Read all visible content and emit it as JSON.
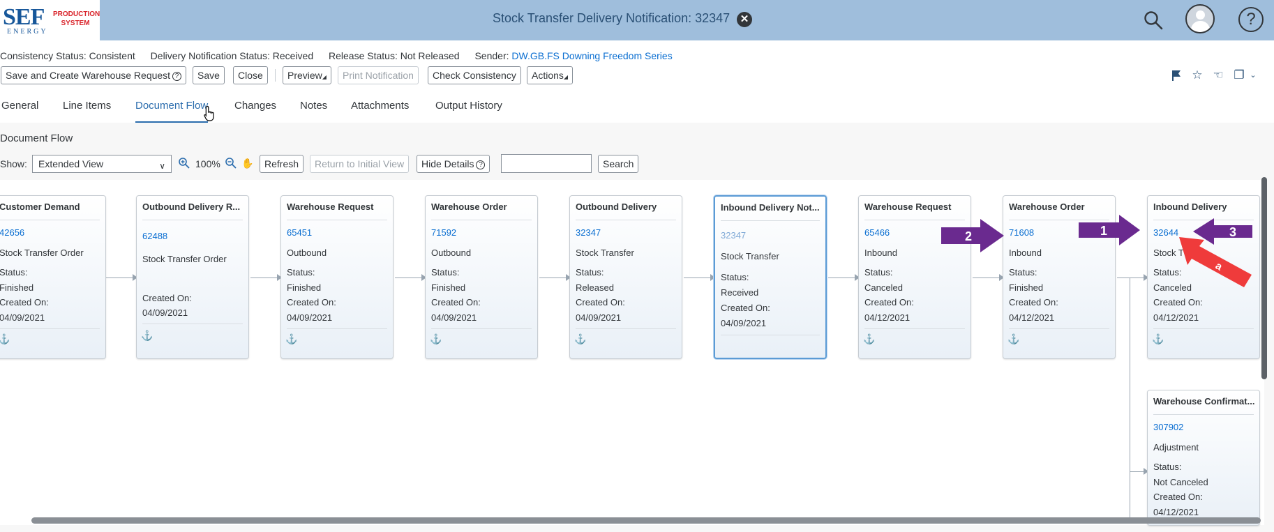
{
  "header": {
    "logo_text": "SEF",
    "logo_sub": "ENERGY",
    "logo_product": "PRODUCTION SYSTEM",
    "title": "Stock Transfer Delivery Notification: 32347"
  },
  "status": {
    "consistency_label": "Consistency Status:",
    "consistency_value": "Consistent",
    "dn_label": "Delivery Notification Status:",
    "dn_value": "Received",
    "release_label": "Release Status:",
    "release_value": "Not Released",
    "sender_label": "Sender:",
    "sender_value": "DW.GB.FS Downing Freedom Series"
  },
  "toolbar": {
    "save_create": "Save and Create Warehouse Request",
    "save": "Save",
    "close": "Close",
    "preview": "Preview",
    "print": "Print Notification",
    "check": "Check Consistency",
    "actions": "Actions"
  },
  "tabs": [
    "General",
    "Line Items",
    "Document Flow",
    "Changes",
    "Notes",
    "Attachments",
    "Output History"
  ],
  "flow": {
    "section_title": "Document Flow",
    "show_label": "Show:",
    "show_value": "Extended View",
    "zoom": "100%",
    "refresh": "Refresh",
    "return": "Return to Initial View",
    "hide_details": "Hide Details",
    "search": "Search",
    "search_value": ""
  },
  "nodes": [
    {
      "title": "Customer Demand",
      "id": "42656",
      "type": "Stock Transfer Order",
      "status_label": "Status:",
      "status": "Finished",
      "created_label": "Created On:",
      "date": "04/09/2021"
    },
    {
      "title": "Outbound Delivery R...",
      "id": "62488",
      "type": "Stock Transfer Order",
      "created_label": "Created On:",
      "date": "04/09/2021"
    },
    {
      "title": "Warehouse Request",
      "id": "65451",
      "type": "Outbound",
      "status_label": "Status:",
      "status": "Finished",
      "created_label": "Created On:",
      "date": "04/09/2021"
    },
    {
      "title": "Warehouse Order",
      "id": "71592",
      "type": "Outbound",
      "status_label": "Status:",
      "status": "Finished",
      "created_label": "Created On:",
      "date": "04/09/2021"
    },
    {
      "title": "Outbound Delivery",
      "id": "32347",
      "type": "Stock Transfer",
      "status_label": "Status:",
      "status": "Released",
      "created_label": "Created On:",
      "date": "04/09/2021"
    },
    {
      "title": "Inbound Delivery Not...",
      "id": "32347",
      "type": "Stock Transfer",
      "status_label": "Status:",
      "status": "Received",
      "created_label": "Created On:",
      "date": "04/09/2021"
    },
    {
      "title": "Warehouse Request",
      "id": "65466",
      "type": "Inbound",
      "status_label": "Status:",
      "status": "Canceled",
      "created_label": "Created On:",
      "date": "04/12/2021"
    },
    {
      "title": "Warehouse Order",
      "id": "71608",
      "type": "Inbound",
      "status_label": "Status:",
      "status": "Finished",
      "created_label": "Created On:",
      "date": "04/12/2021"
    },
    {
      "title": "Inbound Delivery",
      "id": "32644",
      "type": "Stock T",
      "status_label": "Status:",
      "status": "Canceled",
      "created_label": "Created On:",
      "date": "04/12/2021"
    },
    {
      "title": "Warehouse Confirmat...",
      "id": "307902",
      "type": "Adjustment",
      "status_label": "Status:",
      "status": "Not Canceled",
      "created_label": "Created On:",
      "date": "04/12/2021"
    }
  ],
  "callouts": {
    "c1": "1",
    "c2": "2",
    "c3": "3",
    "ca": "a"
  },
  "colors": {
    "header_bg": "#9fbedc",
    "link": "#0a6ed1",
    "callout_purple": "#6a2a8f",
    "callout_red": "#ef3b3b"
  }
}
